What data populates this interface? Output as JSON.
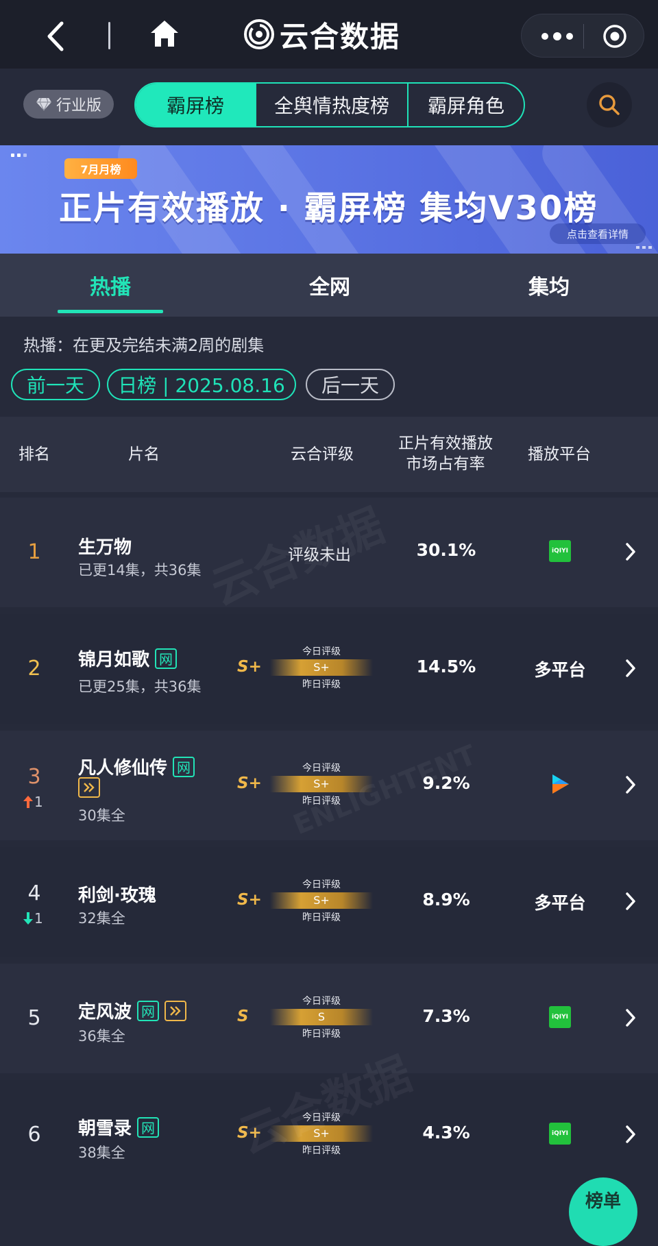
{
  "header": {
    "brand": "云合数据"
  },
  "filter": {
    "industry_badge": "行业版",
    "segments": [
      "霸屏榜",
      "全舆情热度榜",
      "霸屏角色"
    ]
  },
  "banner": {
    "tag": "7月月榜",
    "title": "正片有效播放 · 霸屏榜 集均V30榜",
    "detail": "点击查看详情"
  },
  "tabs": [
    "热播",
    "全网",
    "集均"
  ],
  "description": "热播：在更及完结未满2周的剧集",
  "date_nav": {
    "prev": "前一天",
    "current": "日榜 | 2025.08.16",
    "next": "后一天"
  },
  "table": {
    "headers": {
      "rank": "排名",
      "title": "片名",
      "rating": "云合评级",
      "share_line1": "正片有效播放",
      "share_line2": "市场占有率",
      "platform": "播放平台"
    },
    "gauge_top": "今日评级",
    "gauge_bottom": "昨日评级",
    "rows": [
      {
        "rank": "1",
        "title": "生万物",
        "sub": "已更14集，共36集",
        "rating": "评级未出",
        "share": "30.1%",
        "platform": "iqiyi"
      },
      {
        "rank": "2",
        "title": "锦月如歌",
        "wang": "网",
        "sub": "已更25集，共36集",
        "rating": "S+",
        "gauge": "S+",
        "share": "14.5%",
        "platform": "多平台"
      },
      {
        "rank": "3",
        "title": "凡人修仙传",
        "wang": "网",
        "sub": "30集全",
        "rating": "S+",
        "gauge": "S+",
        "share": "9.2%",
        "platform": "youku",
        "move": "1"
      },
      {
        "rank": "4",
        "title": "利剑·玫瑰",
        "sub": "32集全",
        "rating": "S+",
        "gauge": "S+",
        "share": "8.9%",
        "platform": "多平台",
        "move": "1"
      },
      {
        "rank": "5",
        "title": "定风波",
        "wang": "网",
        "sub": "36集全",
        "rating": "S",
        "gauge": "S",
        "share": "7.3%",
        "platform": "iqiyi"
      },
      {
        "rank": "6",
        "title": "朝雪录",
        "wang": "网",
        "sub": "38集全",
        "rating": "S+",
        "gauge": "S+",
        "share": "4.3%",
        "platform": "iqiyi"
      }
    ]
  },
  "platform_logo_text": "iQIYI",
  "float_button": "榜单",
  "watermark": {
    "cn": "云合数据",
    "en": "ENLIGHTENT"
  },
  "colors": {
    "accent": "#20e8bb",
    "gold": "#f0b84a",
    "up": "#ff6a3d",
    "down": "#22e4b7"
  }
}
